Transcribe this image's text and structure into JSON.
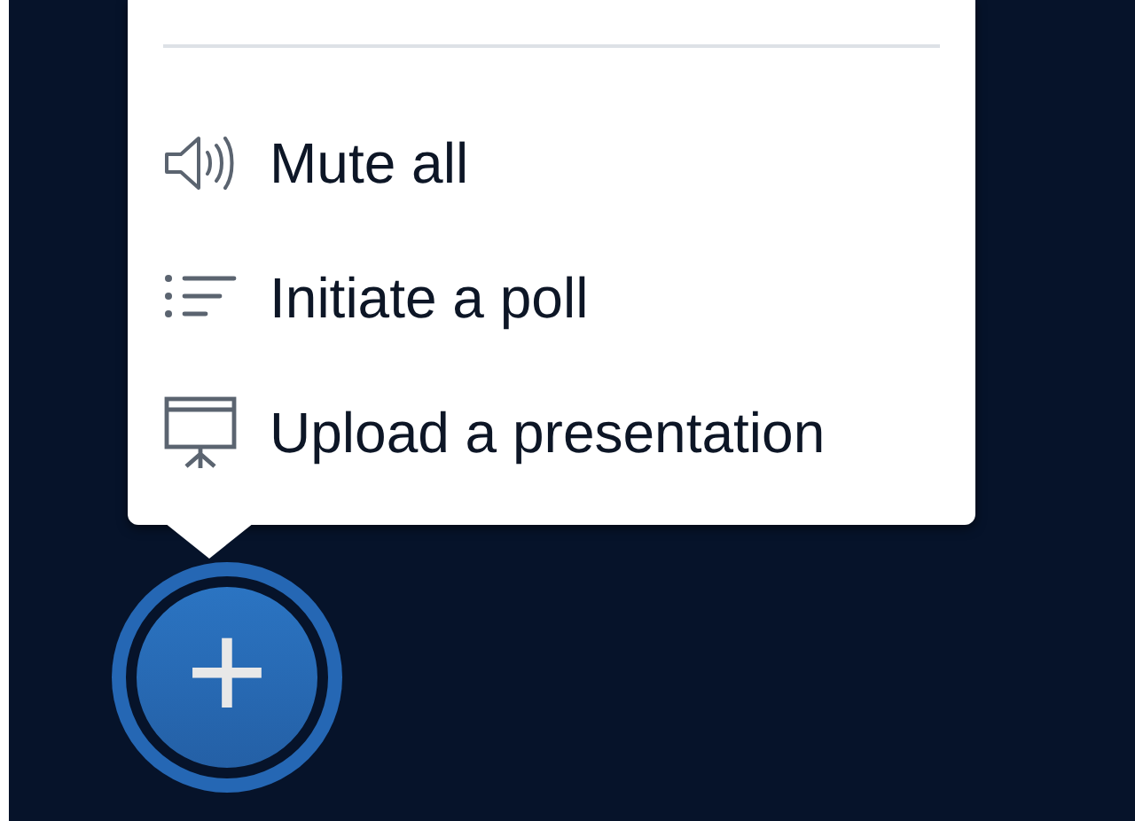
{
  "menu": {
    "items": [
      {
        "label": "Mute all"
      },
      {
        "label": "Initiate a poll"
      },
      {
        "label": "Upload a presentation"
      }
    ]
  },
  "add_button": {
    "label": "+"
  }
}
